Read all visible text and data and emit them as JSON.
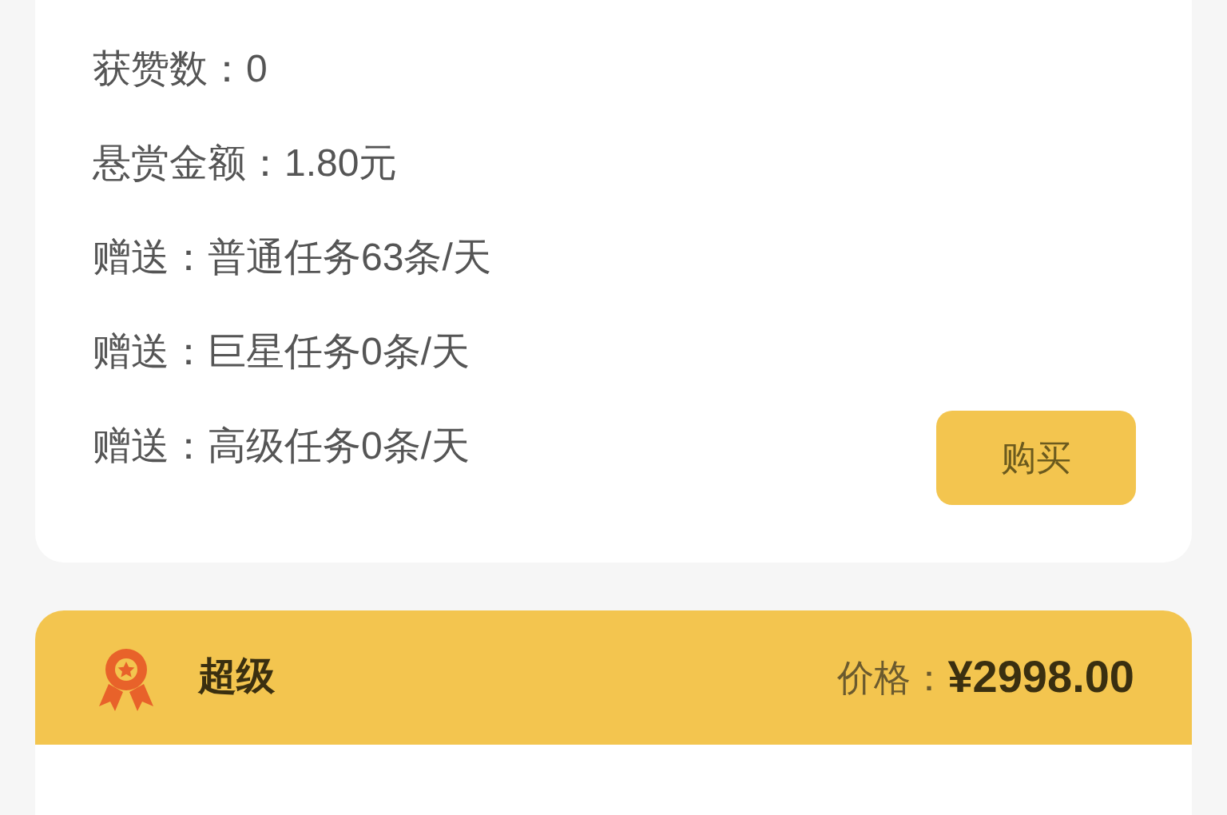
{
  "plan_card": {
    "rows": [
      "获赞数：0",
      "悬赏金额：1.80元",
      "赠送：普通任务63条/天",
      "赠送：巨星任务0条/天",
      "赠送：高级任务0条/天"
    ],
    "buy_button": "购买"
  },
  "next_plan": {
    "title": "超级",
    "price_label": "价格：",
    "price": "¥2998.00"
  }
}
